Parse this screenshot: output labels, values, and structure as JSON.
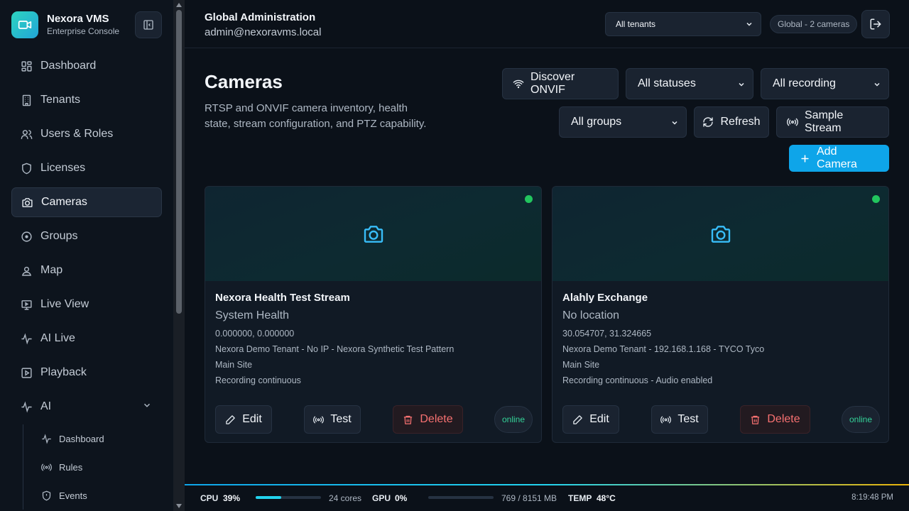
{
  "brand": {
    "name": "Nexora VMS",
    "subtitle": "Enterprise Console"
  },
  "sidebar": {
    "items": [
      {
        "label": "Dashboard",
        "icon": "dashboard-icon"
      },
      {
        "label": "Tenants",
        "icon": "building-icon"
      },
      {
        "label": "Users & Roles",
        "icon": "users-icon"
      },
      {
        "label": "Licenses",
        "icon": "shield-icon"
      },
      {
        "label": "Cameras",
        "icon": "camera-icon",
        "active": true
      },
      {
        "label": "Groups",
        "icon": "target-icon"
      },
      {
        "label": "Map",
        "icon": "map-pin-icon"
      },
      {
        "label": "Live View",
        "icon": "monitor-icon"
      },
      {
        "label": "AI Live",
        "icon": "activity-icon"
      },
      {
        "label": "Playback",
        "icon": "play-square-icon"
      },
      {
        "label": "AI",
        "icon": "activity-icon",
        "expanded": true
      }
    ],
    "ai_subitems": [
      {
        "label": "Dashboard",
        "icon": "activity-icon"
      },
      {
        "label": "Rules",
        "icon": "broadcast-icon"
      },
      {
        "label": "Events",
        "icon": "shield-icon"
      }
    ]
  },
  "header": {
    "title": "Global Administration",
    "user": "admin@nexoravms.local",
    "tenant_select": "All tenants",
    "scope_badge": "Global - 2 cameras"
  },
  "page": {
    "title": "Cameras",
    "description": "RTSP and ONVIF camera inventory, health state, stream configuration, and PTZ capability.",
    "discover_label": "Discover ONVIF",
    "status_filter": "All statuses",
    "recording_filter": "All recording",
    "group_filter": "All groups",
    "refresh_label": "Refresh",
    "sample_label": "Sample Stream",
    "add_label": "Add Camera"
  },
  "cameras": [
    {
      "name": "Nexora Health Test Stream",
      "location": "System Health",
      "coords": "0.000000, 0.000000",
      "details": "Nexora Demo Tenant - No IP - Nexora Synthetic Test Pattern",
      "site": "Main Site",
      "recording": "Recording continuous",
      "status": "online",
      "edit": "Edit",
      "test": "Test",
      "delete": "Delete"
    },
    {
      "name": "Alahly Exchange",
      "location": "No location",
      "coords": "30.054707, 31.324665",
      "details": "Nexora Demo Tenant - 192.168.1.168 - TYCO Tyco",
      "site": "Main Site",
      "recording": "Recording continuous - Audio enabled",
      "status": "online",
      "edit": "Edit",
      "test": "Test",
      "delete": "Delete"
    }
  ],
  "statusbar": {
    "cpu_label": "CPU",
    "cpu_value": "39%",
    "cpu_fraction": 0.39,
    "cpu_cores": "24 cores",
    "gpu_label": "GPU",
    "gpu_value": "0%",
    "gpu_fraction": 0.0,
    "gpu_mem": "769 / 8151 MB",
    "temp_label": "TEMP",
    "temp_value": "48°C",
    "time": "8:19:48 PM"
  },
  "colors": {
    "accent": "#0ea5e9",
    "online": "#22c55e",
    "danger": "#f87171",
    "brand_gradient_start": "#2dd4bf"
  }
}
